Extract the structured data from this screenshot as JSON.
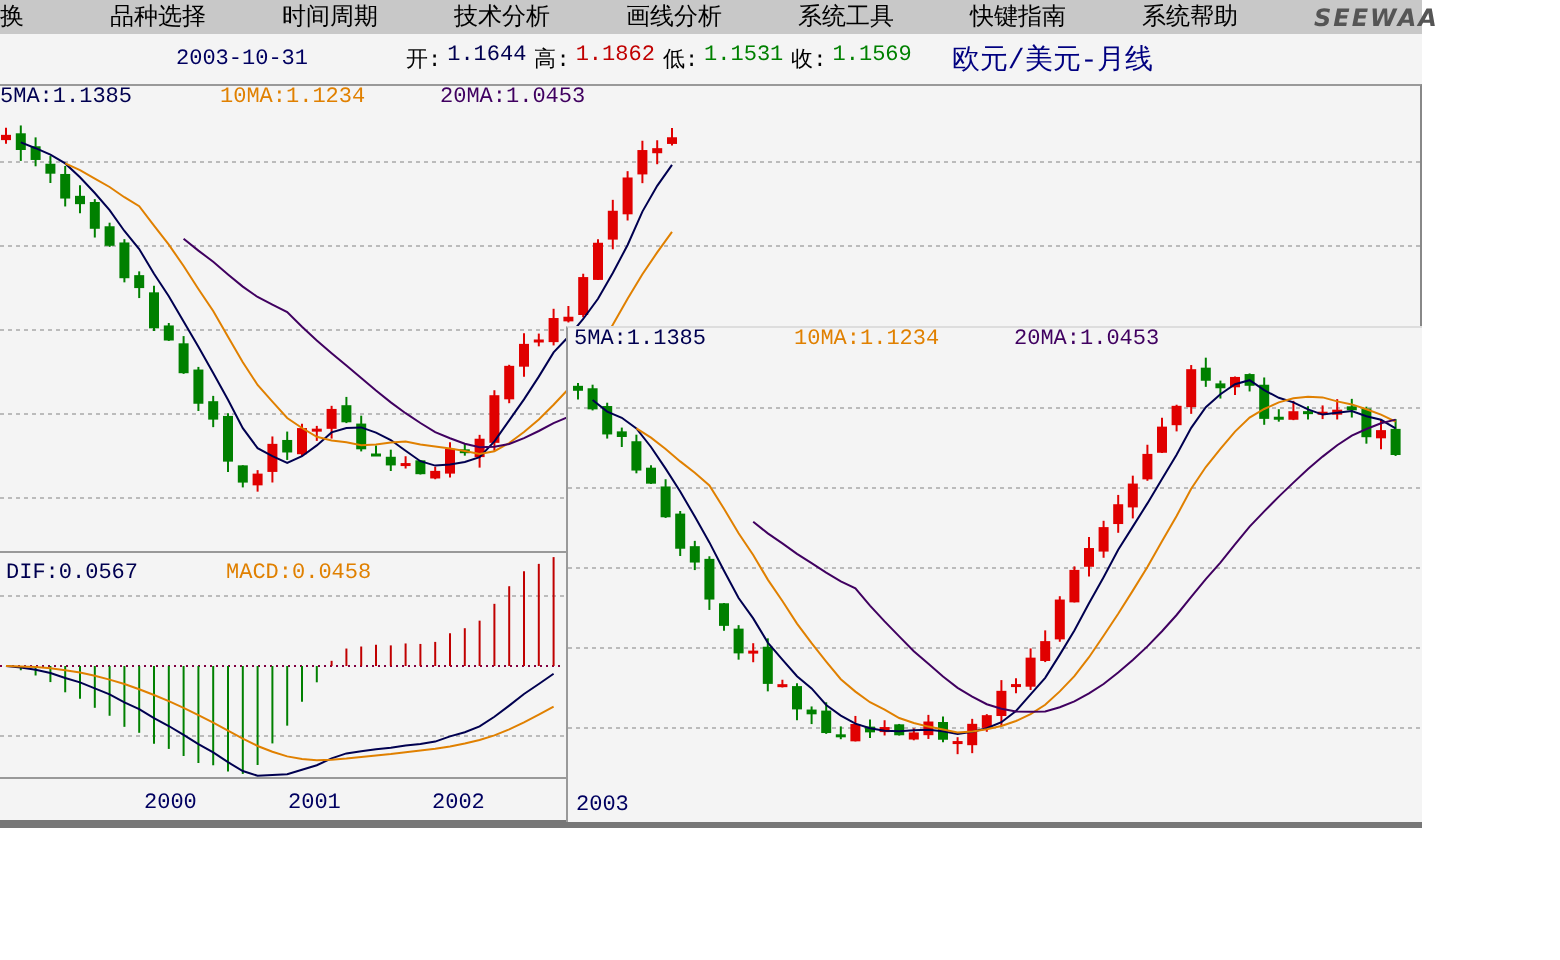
{
  "menu": [
    "换",
    "品种选择",
    "时间周期",
    "技术分析",
    "画线分析",
    "系统工具",
    "快键指南",
    "系统帮助"
  ],
  "logo": "SEEWAA",
  "header": {
    "date": "2003-10-31",
    "title": "欧元/美元-月线",
    "quote": [
      {
        "label": "开:",
        "value": "1.1644",
        "kind": "open"
      },
      {
        "label": "高:",
        "value": "1.1862",
        "kind": "high"
      },
      {
        "label": "低:",
        "value": "1.1531",
        "kind": "low"
      },
      {
        "label": "收:",
        "value": "1.1569",
        "kind": "close"
      }
    ]
  },
  "back_chart": {
    "ma": [
      {
        "label": "5MA:1.1385",
        "kind": "ma5"
      },
      {
        "label": "10MA:1.1234",
        "kind": "ma10"
      },
      {
        "label": "20MA:1.0453",
        "kind": "ma20"
      }
    ],
    "macd": [
      {
        "label": "DIF:0.0567",
        "kind": "dif"
      },
      {
        "label": "MACD:0.0458",
        "kind": "macd"
      }
    ],
    "years": [
      "2000",
      "2001",
      "2002"
    ]
  },
  "front_chart": {
    "ma": [
      {
        "label": "5MA:1.1385",
        "kind": "ma5"
      },
      {
        "label": "10MA:1.1234",
        "kind": "ma10"
      },
      {
        "label": "20MA:1.0453",
        "kind": "ma20"
      }
    ],
    "years": [
      "2003"
    ]
  }
}
